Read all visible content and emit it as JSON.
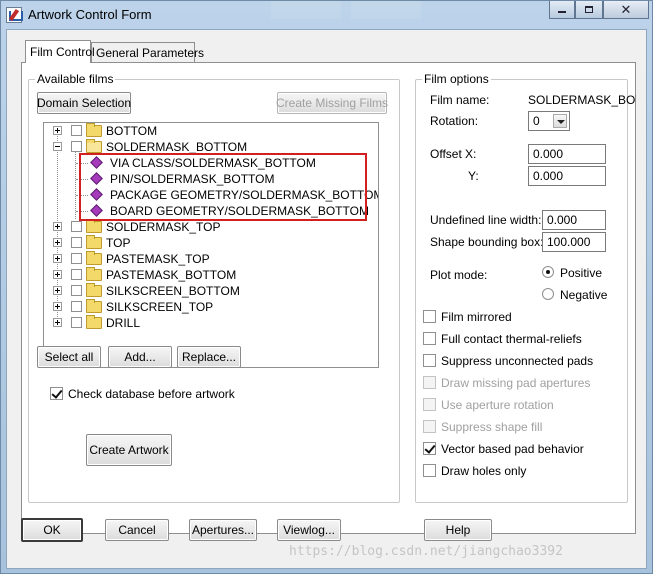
{
  "window": {
    "title": "Artwork Control Form",
    "controls": [
      "minimize",
      "restore",
      "close"
    ]
  },
  "tabs": [
    {
      "label": "Film Control",
      "active": true
    },
    {
      "label": "General Parameters",
      "active": false
    }
  ],
  "available_films": {
    "label": "Available films",
    "domain_selection": "Domain Selection",
    "create_missing_films": "Create Missing Films",
    "tree": [
      {
        "label": "BOTTOM",
        "type": "folder",
        "expander": "+"
      },
      {
        "label": "SOLDERMASK_BOTTOM",
        "type": "folder-open",
        "expander": "-"
      },
      {
        "label": "VIA CLASS/SOLDERMASK_BOTTOM",
        "type": "layer"
      },
      {
        "label": "PIN/SOLDERMASK_BOTTOM",
        "type": "layer"
      },
      {
        "label": "PACKAGE GEOMETRY/SOLDERMASK_BOTTOM",
        "type": "layer"
      },
      {
        "label": "BOARD GEOMETRY/SOLDERMASK_BOTTOM",
        "type": "layer"
      },
      {
        "label": "SOLDERMASK_TOP",
        "type": "folder",
        "expander": "+"
      },
      {
        "label": "TOP",
        "type": "folder",
        "expander": "+"
      },
      {
        "label": "PASTEMASK_TOP",
        "type": "folder",
        "expander": "+"
      },
      {
        "label": "PASTEMASK_BOTTOM",
        "type": "folder",
        "expander": "+"
      },
      {
        "label": "SILKSCREEN_BOTTOM",
        "type": "folder",
        "expander": "+"
      },
      {
        "label": "SILKSCREEN_TOP",
        "type": "folder",
        "expander": "+"
      },
      {
        "label": "DRILL",
        "type": "folder",
        "expander": "+"
      }
    ],
    "select_all": "Select all",
    "add": "Add...",
    "replace": "Replace..."
  },
  "check_database": {
    "label": "Check database before artwork",
    "checked": true
  },
  "create_artwork": "Create Artwork",
  "film_options": {
    "label": "Film options",
    "film_name_label": "Film name:",
    "film_name_value": "SOLDERMASK_BOTT",
    "rotation_label": "Rotation:",
    "rotation_value": "0",
    "offset_label": "Offset",
    "x_label": "X:",
    "x_value": "0.000",
    "y_label": "Y:",
    "y_value": "0.000",
    "undefined_line_width_label": "Undefined line width:",
    "undefined_line_width_value": "0.000",
    "shape_bounding_box_label": "Shape bounding box:",
    "shape_bounding_box_value": "100.000",
    "plot_mode_label": "Plot mode:",
    "plot_mode_options": [
      {
        "label": "Positive",
        "selected": true
      },
      {
        "label": "Negative",
        "selected": false
      }
    ],
    "checkboxes": [
      {
        "label": "Film mirrored",
        "checked": false,
        "enabled": true
      },
      {
        "label": "Full contact thermal-reliefs",
        "checked": false,
        "enabled": true
      },
      {
        "label": "Suppress unconnected pads",
        "checked": false,
        "enabled": true
      },
      {
        "label": "Draw missing pad apertures",
        "checked": false,
        "enabled": false
      },
      {
        "label": "Use aperture rotation",
        "checked": false,
        "enabled": false
      },
      {
        "label": "Suppress shape fill",
        "checked": false,
        "enabled": false
      },
      {
        "label": "Vector based pad behavior",
        "checked": true,
        "enabled": true
      },
      {
        "label": "Draw holes only",
        "checked": false,
        "enabled": true
      }
    ]
  },
  "footer": {
    "ok": "OK",
    "cancel": "Cancel",
    "apertures": "Apertures...",
    "viewlog": "Viewlog...",
    "help": "Help"
  },
  "watermark": "https://blog.csdn.net/jiangchao3392",
  "colors": {
    "highlight_box": "#d21f1f",
    "layer_icon": "#a53bbb",
    "folder": "#f3d96a"
  }
}
